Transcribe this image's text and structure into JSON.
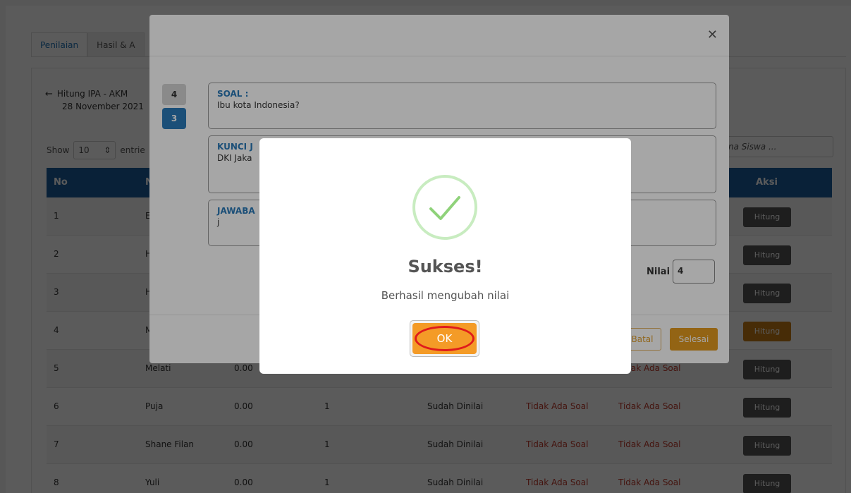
{
  "tabs": [
    {
      "label": "Penilaian"
    },
    {
      "label": "Hasil & A"
    }
  ],
  "back": {
    "title": "Hitung IPA - AKM",
    "date": "28 November 2021"
  },
  "length": {
    "show": "Show",
    "value": "10",
    "suffix": "entrie"
  },
  "search": {
    "placeholder": "na Siswa ..."
  },
  "table": {
    "headers": {
      "no": "No",
      "nama": "N",
      "aksi": "Aksi"
    },
    "action_label": "Hitung",
    "rows": [
      {
        "no": "1",
        "name": "E",
        "score": "",
        "count": "",
        "status": "",
        "c1": "",
        "c2": ""
      },
      {
        "no": "2",
        "name": "H",
        "score": "",
        "count": "",
        "status": "",
        "c1": "",
        "c2": ""
      },
      {
        "no": "3",
        "name": "H",
        "score": "",
        "count": "",
        "status": "",
        "c1": "",
        "c2": ""
      },
      {
        "no": "4",
        "name": "M",
        "score": "",
        "count": "",
        "status": "",
        "c1": "",
        "c2": ""
      },
      {
        "no": "5",
        "name": "Melati",
        "score": "0.00",
        "count": "",
        "status": "",
        "c1": "",
        "c2": "Tidak Ada Soal"
      },
      {
        "no": "6",
        "name": "Puja",
        "score": "0.00",
        "count": "1",
        "status": "Sudah Dinilai",
        "c1": "Tidak Ada Soal",
        "c2": "Tidak Ada Soal"
      },
      {
        "no": "7",
        "name": "Shane Filan",
        "score": "0.00",
        "count": "1",
        "status": "Sudah Dinilai",
        "c1": "Tidak Ada Soal",
        "c2": "Tidak Ada Soal"
      },
      {
        "no": "8",
        "name": "Yuli",
        "score": "0.00",
        "count": "1",
        "status": "Sudah Dinilai",
        "c1": "Tidak Ada Soal",
        "c2": "Tidak Ada Soal"
      }
    ]
  },
  "modal": {
    "close_icon": "close-icon",
    "questions": [
      {
        "num": "4"
      },
      {
        "num": "3"
      }
    ],
    "soal": {
      "title": "SOAL :",
      "text": "Ibu kota Indonesia?"
    },
    "kunci": {
      "title": "KUNCI J",
      "text": "DKI Jaka"
    },
    "jawaban": {
      "title": "JAWABA",
      "text": "j"
    },
    "nilai_label": "Nilai",
    "nilai_value": "4",
    "batal": "Batal",
    "selesai": "Selesai"
  },
  "alert": {
    "icon": "success-check-icon",
    "title": "Sukses!",
    "text": "Berhasil mengubah nilai",
    "ok": "OK"
  },
  "colors": {
    "header": "#1a5f9e",
    "accent": "#2a7ab8",
    "ok": "#f49b27",
    "highlight": "#e01b1b"
  }
}
